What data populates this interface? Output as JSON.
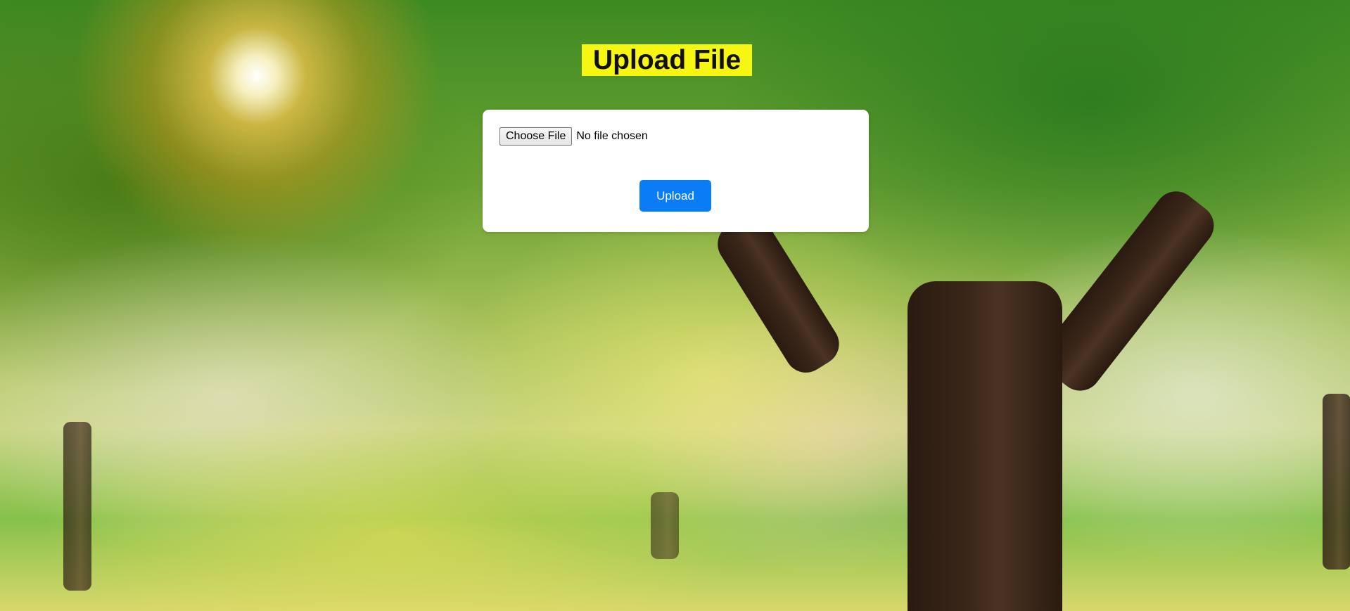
{
  "page": {
    "title": "Upload File"
  },
  "form": {
    "choose_file_label": "Choose File",
    "file_status": "No file chosen",
    "upload_label": "Upload"
  },
  "colors": {
    "title_highlight": "#f6f612",
    "upload_button": "#0a7cf5",
    "card_background": "#ffffff"
  },
  "background": {
    "description_icon": "orchard-tree-photo"
  }
}
